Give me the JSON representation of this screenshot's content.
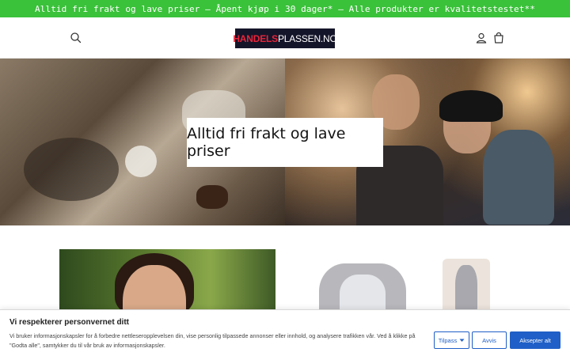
{
  "announcement": {
    "text": "Alltid fri frakt og lave priser – Åpent kjøp i 30 dager* — Alle produkter er kvalitetstestet**"
  },
  "header": {
    "logo_part1": "HANDELS",
    "logo_part2": "PLASSEN.NO",
    "icons": {
      "search": "search-icon",
      "account": "account-icon",
      "cart": "cart-icon"
    }
  },
  "hero": {
    "caption": "Alltid fri frakt og lave priser"
  },
  "cookie_banner": {
    "title": "Vi respekterer personvernet ditt",
    "text": "Vi bruker informasjonskapsler for å forbedre nettleseropplevelsen din, vise personlig tilpassede annonser eller innhold, og analysere trafikken vår. Ved å klikke på \"Godta alle\", samtykker du til vår bruk av informasjonskapsler.",
    "customize_label": "Tilpass",
    "reject_label": "Avvis",
    "accept_label": "Aksepter alt"
  },
  "colors": {
    "announcement_bg": "#3ac23a",
    "logo_bg": "#15152a",
    "logo_accent": "#e8253a",
    "primary_button": "#1f5fc7"
  }
}
